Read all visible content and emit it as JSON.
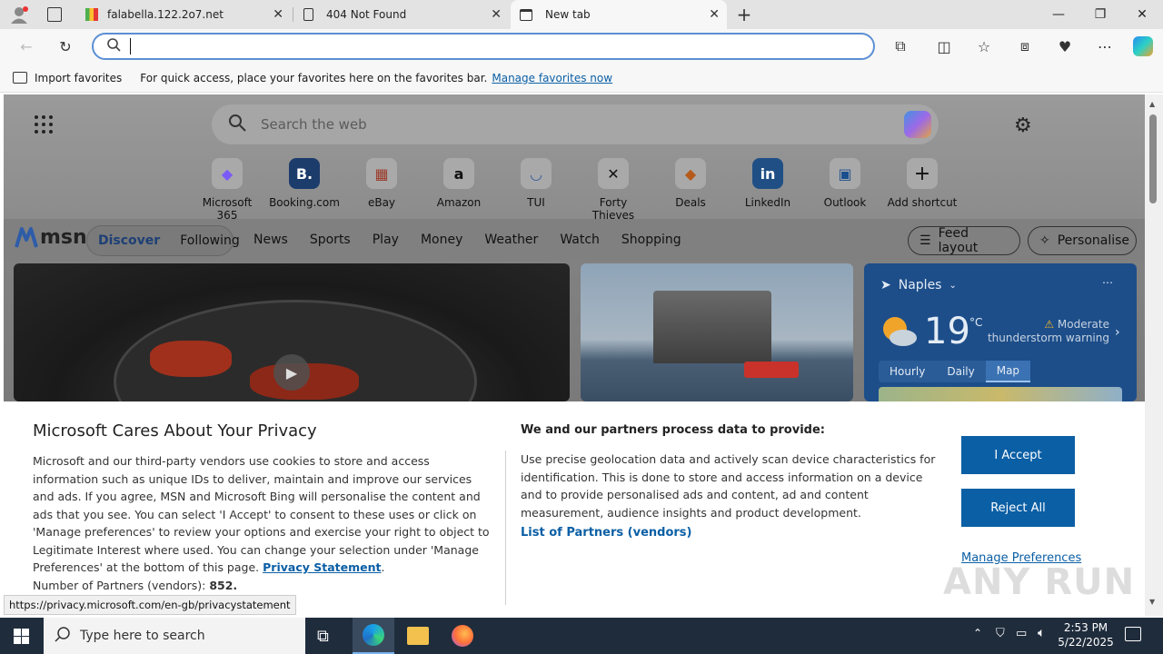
{
  "tabs": [
    {
      "title": "falabella.122.2o7.net",
      "icon": "chart-favicon"
    },
    {
      "title": "404 Not Found",
      "icon": "page-icon"
    },
    {
      "title": "New tab",
      "icon": "newtab-icon"
    }
  ],
  "address": {
    "value": ""
  },
  "favorites_bar": {
    "import_label": "Import favorites",
    "hint": "For quick access, place your favorites here on the favorites bar.",
    "manage_link": "Manage favorites now"
  },
  "ntp": {
    "search_placeholder": "Search the web",
    "quick_links": [
      {
        "label": "Microsoft 365",
        "glyph": "◆",
        "color": "#7a5af8"
      },
      {
        "label": "Booking.com",
        "glyph": "B.",
        "color": "#003580"
      },
      {
        "label": "eBay",
        "glyph": "▦",
        "color": "#e53238"
      },
      {
        "label": "Amazon",
        "glyph": "a",
        "color": "#111111"
      },
      {
        "label": "TUI",
        "glyph": "◡",
        "color": "#1e73be"
      },
      {
        "label": "Forty Thieves",
        "glyph": "✕",
        "color": "#111111"
      },
      {
        "label": "Deals",
        "glyph": "◆",
        "color": "#e86a1a"
      },
      {
        "label": "LinkedIn",
        "glyph": "in",
        "color": "#0a66c2"
      },
      {
        "label": "Outlook",
        "glyph": "▣",
        "color": "#0f6cbd"
      },
      {
        "label": "Add shortcut",
        "glyph": "+",
        "color": "#333333"
      }
    ]
  },
  "msn": {
    "logo": "msn",
    "tabs": [
      "Discover",
      "Following"
    ],
    "nav": [
      "News",
      "Sports",
      "Play",
      "Money",
      "Weather",
      "Watch",
      "Shopping"
    ],
    "feed_layout": "Feed layout",
    "personalise": "Personalise"
  },
  "weather": {
    "location": "Naples",
    "temp": "19",
    "unit": "°C",
    "alert_line1": "Moderate",
    "alert_line2": "thunderstorm warning",
    "tabs": [
      "Hourly",
      "Daily",
      "Map"
    ]
  },
  "consent": {
    "title": "Microsoft Cares About Your Privacy",
    "body": "Microsoft and our third-party vendors use cookies to store and access information such as unique IDs to deliver, maintain and improve our services and ads. If you agree, MSN and Microsoft Bing will personalise the content and ads that you see. You can select 'I Accept' to consent to these uses or click on 'Manage preferences' to review your options and exercise your right to object to Legitimate Interest where used.  You can change your selection under 'Manage Preferences' at the bottom of this page.",
    "privacy_link": "Privacy Statement",
    "partners_label": "Number of Partners (vendors):",
    "partners_count": "852.",
    "right_title": "We and our partners process data to provide:",
    "right_body": "Use precise geolocation data and actively scan device characteristics for identification. This is done to store and access information on a device and to provide personalised ads and content, ad and content measurement, audience insights and product development.",
    "vendors_link": "List of Partners (vendors)",
    "accept": "I Accept",
    "reject": "Reject All",
    "manage": "Manage Preferences"
  },
  "status_url": "https://privacy.microsoft.com/en-gb/privacystatement",
  "taskbar": {
    "search_placeholder": "Type here to search",
    "time": "2:53 PM",
    "date": "5/22/2025"
  },
  "watermark": "ANY RUN"
}
